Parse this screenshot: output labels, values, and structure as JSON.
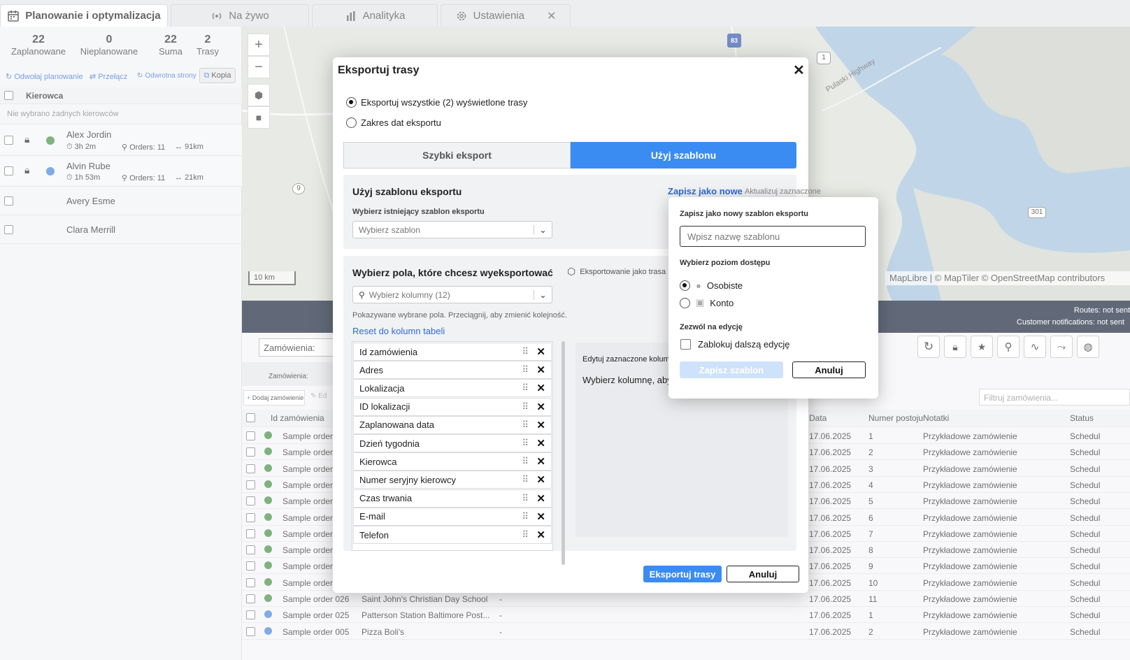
{
  "tabs": [
    {
      "label": "Planowanie i optymalizacja"
    },
    {
      "label": "Na żywo"
    },
    {
      "label": "Analityka"
    },
    {
      "label": "Ustawienia"
    }
  ],
  "stats": [
    {
      "value": "22",
      "label": "Zaplanowane"
    },
    {
      "value": "0",
      "label": "Nieplanowane"
    },
    {
      "value": "22",
      "label": "Suma"
    },
    {
      "value": "2",
      "label": "Trasy"
    }
  ],
  "actions": {
    "unschedule": "Odwołaj planowanie",
    "toggle": "Przełącz",
    "reverse": "Odwrotna strony",
    "copy": "Kopia"
  },
  "drivers": {
    "header": "Kierowca",
    "empty": "Nie wybrano żadnych kierowców",
    "items": [
      {
        "name": "Alex Jordin",
        "time": "3h 2m",
        "orders": "Orders: 11",
        "dist": "91km",
        "color": "#3a8a3a"
      },
      {
        "name": "Alvin Rube",
        "time": "1h 53m",
        "orders": "Orders: 11",
        "dist": "21km",
        "color": "#3b7fd9"
      },
      {
        "name": "Avery Esme"
      },
      {
        "name": "Clara Merrill"
      }
    ]
  },
  "map": {
    "scale": "10 km",
    "attribution": "MapLibre | © MapTiler © OpenStreetMap contributors",
    "labels": {
      "hwy": "Pulaski Highway",
      "r83": "83",
      "r1": "1",
      "r9": "9",
      "r301": "301"
    }
  },
  "status": {
    "routes": "Routes: not sent",
    "customer": "Customer notifications: not sent"
  },
  "orders": {
    "filter_label": "Zamówienia:",
    "group_label": "Zamówienia:",
    "add": "Dodaj zamówienie",
    "edit": "Ed",
    "filter_placeholder": "Filtruj zamówienia...",
    "headers": {
      "id": "Id zamówienia",
      "date": "Data",
      "stop": "Numer postoju",
      "notes": "Notatki",
      "status": "Status"
    },
    "rows": [
      {
        "id": "Sample order",
        "addr": "",
        "loc": "",
        "date": "17.06.2025",
        "stop": "1",
        "notes": "Przykładowe zamówienie",
        "status": "Schedul",
        "color": "#3a8a3a"
      },
      {
        "id": "Sample order",
        "addr": "",
        "loc": "",
        "date": "17.06.2025",
        "stop": "2",
        "notes": "Przykładowe zamówienie",
        "status": "Schedul",
        "color": "#3a8a3a"
      },
      {
        "id": "Sample order",
        "addr": "",
        "loc": "",
        "date": "17.06.2025",
        "stop": "3",
        "notes": "Przykładowe zamówienie",
        "status": "Schedul",
        "color": "#3a8a3a"
      },
      {
        "id": "Sample order",
        "addr": "",
        "loc": "",
        "date": "17.06.2025",
        "stop": "4",
        "notes": "Przykładowe zamówienie",
        "status": "Schedul",
        "color": "#3a8a3a"
      },
      {
        "id": "Sample order",
        "addr": "",
        "loc": "",
        "date": "17.06.2025",
        "stop": "5",
        "notes": "Przykładowe zamówienie",
        "status": "Schedul",
        "color": "#3a8a3a"
      },
      {
        "id": "Sample order",
        "addr": "",
        "loc": "",
        "date": "17.06.2025",
        "stop": "6",
        "notes": "Przykładowe zamówienie",
        "status": "Schedul",
        "color": "#3a8a3a"
      },
      {
        "id": "Sample order",
        "addr": "",
        "loc": "",
        "date": "17.06.2025",
        "stop": "7",
        "notes": "Przykładowe zamówienie",
        "status": "Schedul",
        "color": "#3a8a3a"
      },
      {
        "id": "Sample order",
        "addr": "",
        "loc": "",
        "date": "17.06.2025",
        "stop": "8",
        "notes": "Przykładowe zamówienie",
        "status": "Schedul",
        "color": "#3a8a3a"
      },
      {
        "id": "Sample order",
        "addr": "",
        "loc": "",
        "date": "17.06.2025",
        "stop": "9",
        "notes": "Przykładowe zamówienie",
        "status": "Schedul",
        "color": "#3a8a3a"
      },
      {
        "id": "Sample order",
        "addr": "",
        "loc": "",
        "date": "17.06.2025",
        "stop": "10",
        "notes": "Przykładowe zamówienie",
        "status": "Schedul",
        "color": "#3a8a3a"
      },
      {
        "id": "Sample order 026",
        "addr": "Saint John's Christian Day School",
        "loc": "-",
        "date": "17.06.2025",
        "stop": "11",
        "notes": "Przykładowe zamówienie",
        "status": "Schedul",
        "color": "#3a8a3a"
      },
      {
        "id": "Sample order 025",
        "addr": "Patterson Station Baltimore Post...",
        "loc": "-",
        "date": "17.06.2025",
        "stop": "1",
        "notes": "Przykładowe zamówienie",
        "status": "Schedul",
        "color": "#3b7fd9"
      },
      {
        "id": "Sample order 005",
        "addr": "Pizza Boli's",
        "loc": "-",
        "date": "17.06.2025",
        "stop": "2",
        "notes": "Przykładowe zamówienie",
        "status": "Schedul",
        "color": "#3b7fd9"
      }
    ]
  },
  "modal": {
    "title": "Eksportuj trasy",
    "opt_all": "Eksportuj wszystkie (2) wyświetlone trasy",
    "opt_range": "Zakres dat eksportu",
    "seg_quick": "Szybki eksport",
    "seg_template": "Użyj szablonu",
    "tpl_title": "Użyj szablonu eksportu",
    "save_new": "Zapisz jako nowe",
    "update_sel": "Aktualizuj zaznaczone",
    "tpl_select_label": "Wybierz istniejący szablon eksportu",
    "tpl_select_placeholder": "Wybierz szablon",
    "fields_title": "Wybierz pola, które chcesz wyeksportować",
    "export_as_route": "Eksportowanie jako trasa",
    "cols_placeholder": "Wybierz kolumny (12)",
    "hint": "Pokazywane wybrane pola. Przeciągnij, aby zmienić kolejność.",
    "reset": "Reset do kolumn tabeli",
    "columns": [
      "Id zamówienia",
      "Adres",
      "Lokalizacja",
      "ID lokalizacji",
      "Zaplanowana data",
      "Dzień tygodnia",
      "Kierowca",
      "Numer seryjny kierowcy",
      "Czas trwania",
      "E-mail",
      "Telefon"
    ],
    "edit_title": "Edytuj zaznaczone kolumne",
    "edit_hint": "Wybierz kolumnę, aby",
    "export_btn": "Eksportuj trasy",
    "cancel_btn": "Anuluj"
  },
  "popover": {
    "title": "Zapisz jako nowy szablon eksportu",
    "name_placeholder": "Wpisz nazwę szablonu",
    "access_title": "Wybierz poziom dostępu",
    "personal": "Osobiste",
    "account": "Konto",
    "edit_title": "Zezwól na edycję",
    "lock": "Zablokuj dalszą edycję",
    "save": "Zapisz szablon",
    "cancel": "Anuluj"
  }
}
